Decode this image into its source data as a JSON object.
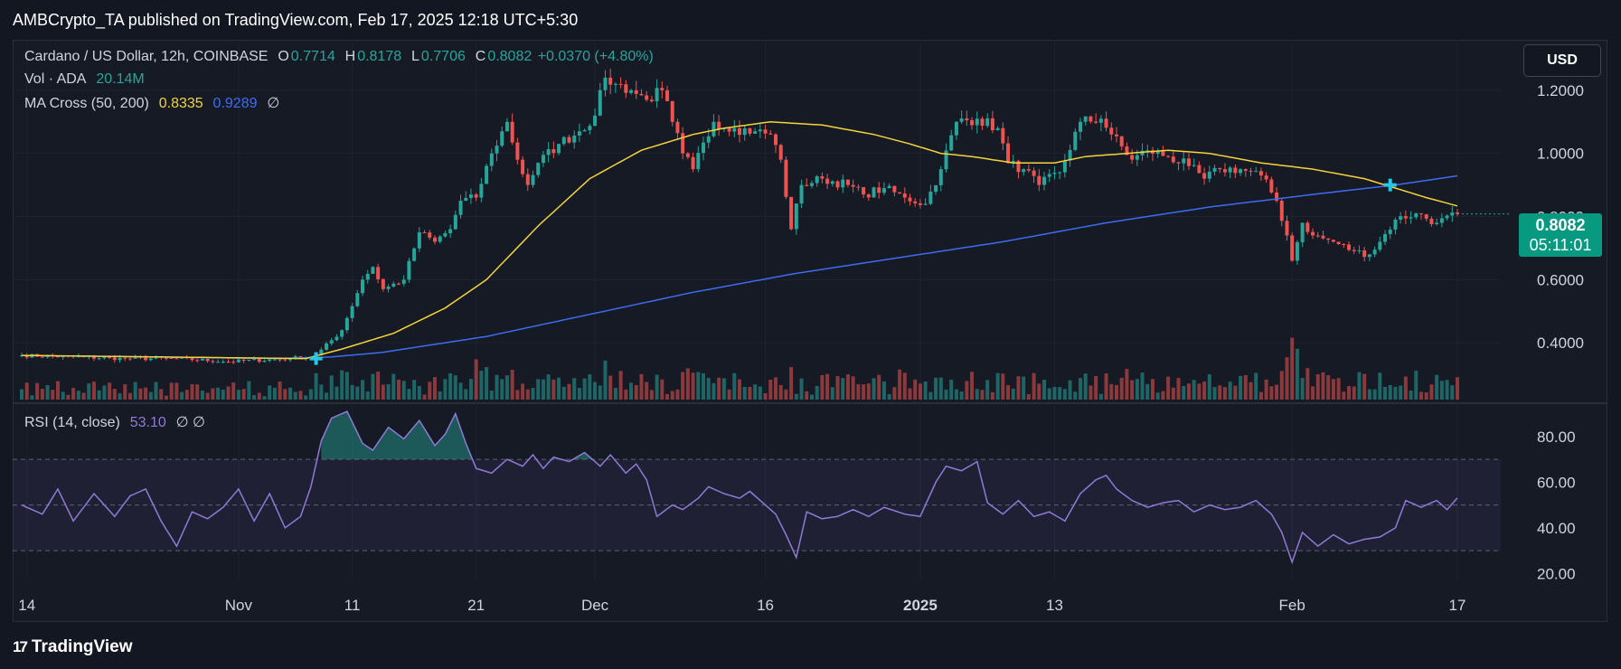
{
  "header": {
    "published": "AMBCrypto_TA published on TradingView.com, Feb 17, 2025 12:18 UTC+5:30"
  },
  "legend": {
    "symbol": "Cardano / US Dollar, 12h, COINBASE",
    "o_label": "O",
    "o_value": "0.7714",
    "h_label": "H",
    "h_value": "0.8178",
    "l_label": "L",
    "l_value": "0.7706",
    "c_label": "C",
    "c_value": "0.8082",
    "change": "+0.0370 (+4.80%)",
    "vol_label": "Vol · ADA",
    "vol_value": "20.14M",
    "ma_label": "MA Cross (50, 200)",
    "ma_fast": "0.8335",
    "ma_slow": "0.9289",
    "ma_extra": "∅",
    "rsi_label": "RSI (14, close)",
    "rsi_value": "53.10",
    "rsi_extra": "∅ ∅"
  },
  "currency_button": "USD",
  "price_tag": {
    "price": "0.8082",
    "countdown": "05:11:01"
  },
  "footer": {
    "brand": "TradingView",
    "logo_glyph": "17"
  },
  "colors": {
    "up": "#26a69a",
    "down": "#ef5350",
    "ma_fast": "#f5d33a",
    "ma_slow": "#3d6cf0",
    "rsi": "#8f7ad8",
    "cross_marker": "#27c5e6"
  },
  "chart_data": [
    {
      "type": "candlestick",
      "series_name": "Cardano / US Dollar, 12h, COINBASE",
      "ylim": [
        0.22,
        1.36
      ],
      "y_ticks": [
        "1.2000",
        "1.0000",
        "0.8000",
        "0.6000",
        "0.4000"
      ],
      "y_tick_values": [
        1.2,
        1.0,
        0.8,
        0.6,
        0.4
      ],
      "x_ticks": [
        "14",
        "Nov",
        "11",
        "21",
        "Dec",
        "16",
        "2025",
        "13",
        "Feb",
        "17"
      ],
      "x_tick_bar_index": [
        1,
        42,
        64,
        88,
        111,
        144,
        174,
        200,
        246,
        278
      ],
      "bar_count": 279,
      "close_anchors": [
        [
          0,
          0.36
        ],
        [
          20,
          0.35
        ],
        [
          30,
          0.35
        ],
        [
          40,
          0.34
        ],
        [
          52,
          0.35
        ],
        [
          57,
          0.36
        ],
        [
          62,
          0.44
        ],
        [
          66,
          0.6
        ],
        [
          68,
          0.64
        ],
        [
          70,
          0.57
        ],
        [
          74,
          0.6
        ],
        [
          77,
          0.75
        ],
        [
          80,
          0.72
        ],
        [
          83,
          0.76
        ],
        [
          85,
          0.85
        ],
        [
          88,
          0.86
        ],
        [
          91,
          1.0
        ],
        [
          94,
          1.1
        ],
        [
          96,
          0.98
        ],
        [
          98,
          0.9
        ],
        [
          100,
          0.97
        ],
        [
          104,
          1.03
        ],
        [
          108,
          1.07
        ],
        [
          111,
          1.12
        ],
        [
          113,
          1.24
        ],
        [
          115,
          1.22
        ],
        [
          118,
          1.2
        ],
        [
          121,
          1.17
        ],
        [
          124,
          1.2
        ],
        [
          126,
          1.1
        ],
        [
          128,
          1.0
        ],
        [
          130,
          0.95
        ],
        [
          134,
          1.1
        ],
        [
          138,
          1.08
        ],
        [
          142,
          1.07
        ],
        [
          145,
          1.06
        ],
        [
          147,
          0.98
        ],
        [
          149,
          0.76
        ],
        [
          151,
          0.9
        ],
        [
          155,
          0.92
        ],
        [
          160,
          0.9
        ],
        [
          163,
          0.87
        ],
        [
          167,
          0.89
        ],
        [
          171,
          0.86
        ],
        [
          175,
          0.84
        ],
        [
          178,
          0.95
        ],
        [
          181,
          1.1
        ],
        [
          185,
          1.11
        ],
        [
          189,
          1.08
        ],
        [
          191,
          0.97
        ],
        [
          194,
          0.95
        ],
        [
          197,
          0.9
        ],
        [
          201,
          0.94
        ],
        [
          205,
          1.1
        ],
        [
          209,
          1.11
        ],
        [
          211,
          1.06
        ],
        [
          215,
          0.98
        ],
        [
          218,
          1.01
        ],
        [
          222,
          0.99
        ],
        [
          226,
          0.96
        ],
        [
          229,
          0.92
        ],
        [
          232,
          0.95
        ],
        [
          236,
          0.95
        ],
        [
          240,
          0.93
        ],
        [
          243,
          0.85
        ],
        [
          245,
          0.74
        ],
        [
          246,
          0.66
        ],
        [
          248,
          0.78
        ],
        [
          250,
          0.74
        ],
        [
          254,
          0.72
        ],
        [
          258,
          0.69
        ],
        [
          261,
          0.68
        ],
        [
          263,
          0.72
        ],
        [
          266,
          0.79
        ],
        [
          270,
          0.81
        ],
        [
          274,
          0.78
        ],
        [
          278,
          0.8082
        ]
      ],
      "ma50_anchors": [
        [
          0,
          0.36
        ],
        [
          55,
          0.35
        ],
        [
          62,
          0.38
        ],
        [
          72,
          0.43
        ],
        [
          82,
          0.51
        ],
        [
          90,
          0.6
        ],
        [
          100,
          0.77
        ],
        [
          110,
          0.92
        ],
        [
          120,
          1.01
        ],
        [
          130,
          1.06
        ],
        [
          136,
          1.08
        ],
        [
          145,
          1.1
        ],
        [
          155,
          1.09
        ],
        [
          165,
          1.06
        ],
        [
          172,
          1.03
        ],
        [
          178,
          1.0
        ],
        [
          184,
          0.99
        ],
        [
          192,
          0.97
        ],
        [
          200,
          0.97
        ],
        [
          206,
          0.99
        ],
        [
          214,
          1.0
        ],
        [
          222,
          1.01
        ],
        [
          230,
          1.0
        ],
        [
          240,
          0.97
        ],
        [
          250,
          0.95
        ],
        [
          260,
          0.92
        ],
        [
          266,
          0.89
        ],
        [
          272,
          0.86
        ],
        [
          278,
          0.8335
        ]
      ],
      "ma200_anchors": [
        [
          0,
          0.36
        ],
        [
          50,
          0.35
        ],
        [
          60,
          0.355
        ],
        [
          70,
          0.37
        ],
        [
          90,
          0.42
        ],
        [
          110,
          0.49
        ],
        [
          130,
          0.56
        ],
        [
          150,
          0.62
        ],
        [
          170,
          0.67
        ],
        [
          190,
          0.72
        ],
        [
          210,
          0.78
        ],
        [
          230,
          0.83
        ],
        [
          250,
          0.87
        ],
        [
          266,
          0.9
        ],
        [
          278,
          0.9289
        ]
      ],
      "cross_markers": [
        {
          "bar": 57,
          "value": 0.35
        },
        {
          "bar": 265,
          "value": 0.9
        }
      ]
    },
    {
      "type": "bar",
      "series_name": "Vol · ADA",
      "last_value": "20.14M",
      "spike_bars": [
        {
          "bar": 62,
          "rel": 0.45
        },
        {
          "bar": 88,
          "rel": 0.62
        },
        {
          "bar": 90,
          "rel": 0.5
        },
        {
          "bar": 113,
          "rel": 0.6
        },
        {
          "bar": 129,
          "rel": 0.48
        },
        {
          "bar": 149,
          "rel": 0.5
        },
        {
          "bar": 190,
          "rel": 0.4
        },
        {
          "bar": 245,
          "rel": 0.65
        },
        {
          "bar": 246,
          "rel": 0.95
        },
        {
          "bar": 247,
          "rel": 0.78
        }
      ]
    },
    {
      "type": "line",
      "series_name": "RSI (14, close)",
      "ylim": [
        17,
        93
      ],
      "y_ticks": [
        "80.00",
        "60.00",
        "40.00",
        "20.00"
      ],
      "y_tick_values": [
        80,
        60,
        40,
        20
      ],
      "bands": [
        30,
        50,
        70
      ],
      "rsi_anchors": [
        [
          0,
          50
        ],
        [
          4,
          46
        ],
        [
          7,
          57
        ],
        [
          10,
          43
        ],
        [
          14,
          55
        ],
        [
          18,
          45
        ],
        [
          21,
          54
        ],
        [
          24,
          57
        ],
        [
          27,
          43
        ],
        [
          30,
          32
        ],
        [
          33,
          47
        ],
        [
          36,
          44
        ],
        [
          39,
          49
        ],
        [
          42,
          57
        ],
        [
          45,
          43
        ],
        [
          48,
          55
        ],
        [
          51,
          40
        ],
        [
          54,
          45
        ],
        [
          56,
          58
        ],
        [
          58,
          78
        ],
        [
          60,
          88
        ],
        [
          63,
          91
        ],
        [
          66,
          77
        ],
        [
          68,
          74
        ],
        [
          71,
          84
        ],
        [
          74,
          79
        ],
        [
          77,
          87
        ],
        [
          80,
          76
        ],
        [
          82,
          81
        ],
        [
          84,
          90
        ],
        [
          86,
          77
        ],
        [
          88,
          66
        ],
        [
          91,
          64
        ],
        [
          94,
          70
        ],
        [
          97,
          67
        ],
        [
          99,
          72
        ],
        [
          101,
          66
        ],
        [
          103,
          71
        ],
        [
          106,
          69
        ],
        [
          109,
          73
        ],
        [
          112,
          67
        ],
        [
          114,
          72
        ],
        [
          117,
          64
        ],
        [
          119,
          68
        ],
        [
          121,
          61
        ],
        [
          123,
          45
        ],
        [
          126,
          50
        ],
        [
          128,
          48
        ],
        [
          131,
          53
        ],
        [
          133,
          58
        ],
        [
          136,
          55
        ],
        [
          139,
          53
        ],
        [
          141,
          56
        ],
        [
          143,
          52
        ],
        [
          146,
          46
        ],
        [
          148,
          37
        ],
        [
          150,
          27
        ],
        [
          152,
          47
        ],
        [
          155,
          44
        ],
        [
          158,
          45
        ],
        [
          161,
          48
        ],
        [
          164,
          45
        ],
        [
          167,
          49
        ],
        [
          171,
          46
        ],
        [
          174,
          45
        ],
        [
          177,
          60
        ],
        [
          179,
          67
        ],
        [
          182,
          65
        ],
        [
          185,
          69
        ],
        [
          187,
          51
        ],
        [
          190,
          46
        ],
        [
          193,
          52
        ],
        [
          196,
          45
        ],
        [
          199,
          47
        ],
        [
          202,
          43
        ],
        [
          205,
          55
        ],
        [
          208,
          61
        ],
        [
          210,
          63
        ],
        [
          212,
          57
        ],
        [
          215,
          52
        ],
        [
          218,
          49
        ],
        [
          221,
          51
        ],
        [
          224,
          52
        ],
        [
          227,
          47
        ],
        [
          230,
          50
        ],
        [
          233,
          48
        ],
        [
          236,
          49
        ],
        [
          239,
          52
        ],
        [
          242,
          46
        ],
        [
          244,
          38
        ],
        [
          246,
          25
        ],
        [
          248,
          38
        ],
        [
          251,
          32
        ],
        [
          254,
          37
        ],
        [
          257,
          33
        ],
        [
          260,
          35
        ],
        [
          263,
          36
        ],
        [
          266,
          40
        ],
        [
          268,
          52
        ],
        [
          271,
          49
        ],
        [
          274,
          52
        ],
        [
          276,
          48
        ],
        [
          278,
          53.1
        ]
      ]
    }
  ]
}
